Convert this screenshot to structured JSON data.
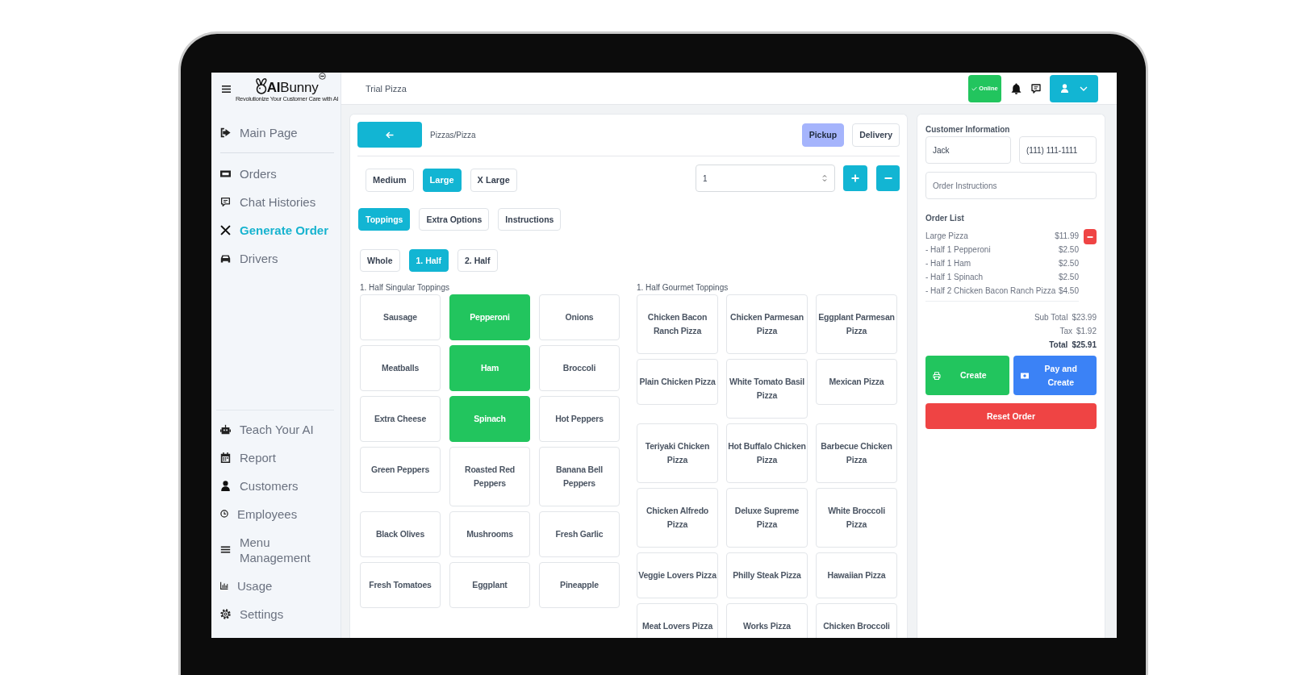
{
  "sidebar": {
    "brand": "**AI**Bunny",
    "tagline": "Revolutionize Your Customer Care with AI",
    "sections": [
      {
        "items": [
          {
            "label": "Main Page",
            "selected": false
          }
        ]
      },
      {
        "items": [
          {
            "label": "Orders",
            "selected": false
          },
          {
            "label": "Chat Histories",
            "selected": false
          },
          {
            "label": "Generate Order",
            "selected": true
          },
          {
            "label": "Drivers",
            "selected": false
          }
        ]
      },
      {
        "items": [
          {
            "label": "Teach Your AI",
            "selected": false
          },
          {
            "label": "Report",
            "selected": false
          },
          {
            "label": "Customers",
            "selected": false
          },
          {
            "label": "Employees",
            "selected": false
          },
          {
            "label": "Menu Management",
            "selected": false
          },
          {
            "label": "Usage",
            "selected": false
          },
          {
            "label": "Settings",
            "selected": false
          }
        ]
      }
    ]
  },
  "header": {
    "title": "Trial Pizza",
    "status": "Online"
  },
  "order": {
    "breadcrumb": "Pizzas/Pizza",
    "order_types": [
      {
        "label": "Pickup",
        "selected": true
      },
      {
        "label": "Delivery",
        "selected": false
      }
    ],
    "sizes": [
      {
        "label": "Medium",
        "selected": false
      },
      {
        "label": "Large",
        "selected": true
      },
      {
        "label": "X Large",
        "selected": false
      }
    ],
    "quantity": "1",
    "tabs": [
      {
        "label": "Toppings",
        "selected": true
      },
      {
        "label": "Extra Options",
        "selected": false
      },
      {
        "label": "Instructions",
        "selected": false
      }
    ],
    "portions": [
      {
        "label": "Whole",
        "selected": false
      },
      {
        "label": "1. Half",
        "selected": true
      },
      {
        "label": "2. Half",
        "selected": false
      }
    ],
    "topping_groups": [
      {
        "title": "1. Half Singular Toppings",
        "items": [
          {
            "label": "Sausage",
            "selected": false
          },
          {
            "label": "Pepperoni",
            "selected": true
          },
          {
            "label": "Onions",
            "selected": false
          },
          {
            "label": "Meatballs",
            "selected": false
          },
          {
            "label": "Ham",
            "selected": true
          },
          {
            "label": "Broccoli",
            "selected": false
          },
          {
            "label": "Extra Cheese",
            "selected": false
          },
          {
            "label": "Spinach",
            "selected": true
          },
          {
            "label": "Hot Peppers",
            "selected": false
          },
          {
            "label": "Green Peppers",
            "selected": false
          },
          {
            "label": "Roasted Red Peppers",
            "selected": false
          },
          {
            "label": "Banana Bell Peppers",
            "selected": false
          },
          {
            "label": "Black Olives",
            "selected": false
          },
          {
            "label": "Mushrooms",
            "selected": false
          },
          {
            "label": "Fresh Garlic",
            "selected": false
          },
          {
            "label": "Fresh Tomatoes",
            "selected": false
          },
          {
            "label": "Eggplant",
            "selected": false
          },
          {
            "label": "Pineapple",
            "selected": false
          }
        ]
      },
      {
        "title": "1. Half Gourmet Toppings",
        "items": [
          {
            "label": "Chicken Bacon Ranch Pizza",
            "selected": false
          },
          {
            "label": "Chicken Parmesan Pizza",
            "selected": false
          },
          {
            "label": "Eggplant Parmesan Pizza",
            "selected": false
          },
          {
            "label": "Plain Chicken Pizza",
            "selected": false
          },
          {
            "label": "White Tomato Basil Pizza",
            "selected": false
          },
          {
            "label": "Mexican Pizza",
            "selected": false
          },
          {
            "label": "Teriyaki Chicken Pizza",
            "selected": false
          },
          {
            "label": "Hot Buffalo Chicken Pizza",
            "selected": false
          },
          {
            "label": "Barbecue Chicken Pizza",
            "selected": false
          },
          {
            "label": "Chicken Alfredo Pizza",
            "selected": false
          },
          {
            "label": "Deluxe Supreme Pizza",
            "selected": false
          },
          {
            "label": "White Broccoli Pizza",
            "selected": false
          },
          {
            "label": "Veggie Lovers Pizza",
            "selected": false
          },
          {
            "label": "Philly Steak Pizza",
            "selected": false
          },
          {
            "label": "Hawaiian Pizza",
            "selected": false
          },
          {
            "label": "Meat Lovers Pizza",
            "selected": false
          },
          {
            "label": "Works Pizza",
            "selected": false
          },
          {
            "label": "Chicken Broccoli",
            "selected": false
          }
        ]
      }
    ]
  },
  "summary": {
    "customer_title": "Customer Information",
    "customer_name": "Jack",
    "phone": "(111) 111-1111",
    "instructions_placeholder": "Order Instructions",
    "order_list_title": "Order List",
    "items": [
      {
        "name": "Large Pizza",
        "price": "$11.99",
        "children": [
          {
            "name": "- Half 1 Pepperoni",
            "price": "$2.50"
          },
          {
            "name": "- Half 1 Ham",
            "price": "$2.50"
          },
          {
            "name": "- Half 1 Spinach",
            "price": "$2.50"
          },
          {
            "name": "- Half 2 Chicken Bacon Ranch Pizza",
            "price": "$4.50"
          }
        ]
      }
    ],
    "totals": [
      {
        "label": "Sub Total",
        "value": "$23.99",
        "kind": "line"
      },
      {
        "label": "Tax",
        "value": "$1.92",
        "kind": "line"
      },
      {
        "label": "Total",
        "value": "$25.91",
        "kind": "grand"
      }
    ],
    "actions": [
      {
        "label": "Create",
        "kind": "create"
      },
      {
        "label": "Pay and Create",
        "kind": "pay"
      }
    ],
    "reset": "Reset Order"
  }
}
